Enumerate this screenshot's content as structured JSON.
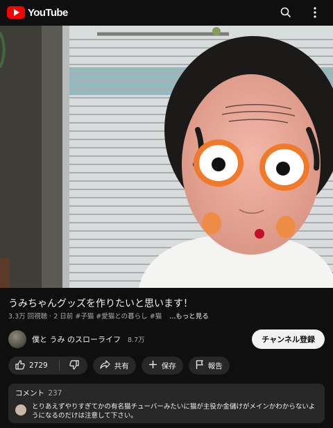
{
  "header": {
    "logo_text": "YouTube",
    "search_icon": "search-icon",
    "more_icon": "more-vertical-icon"
  },
  "video": {
    "title": "うみちゃんグッズを作りたいと思います！",
    "views": "3.3万 回視聴",
    "age": "2 日前",
    "hashtags": "#子猫 #愛猫との暮らし #猫",
    "more_label": "...もっと見る"
  },
  "channel": {
    "name": "僕と うみ のスローライフ",
    "subscribers": "8.7万",
    "subscribe_label": "チャンネル登録"
  },
  "actions": {
    "like_count": "2729",
    "share_label": "共有",
    "save_label": "保存",
    "report_label": "報告"
  },
  "comments": {
    "label": "コメント",
    "count": "237",
    "top_comment": "とりあえずやりすぎてかの有名猫チューバーみたいに猫が主役か金儲けがメインかわからないようになるのだけは注意して下さい。"
  },
  "colors": {
    "background": "#0f0f0f",
    "brand_red": "#ff0000",
    "pill_bg": "#272727",
    "subscribe_bg": "#f1f1f1"
  }
}
